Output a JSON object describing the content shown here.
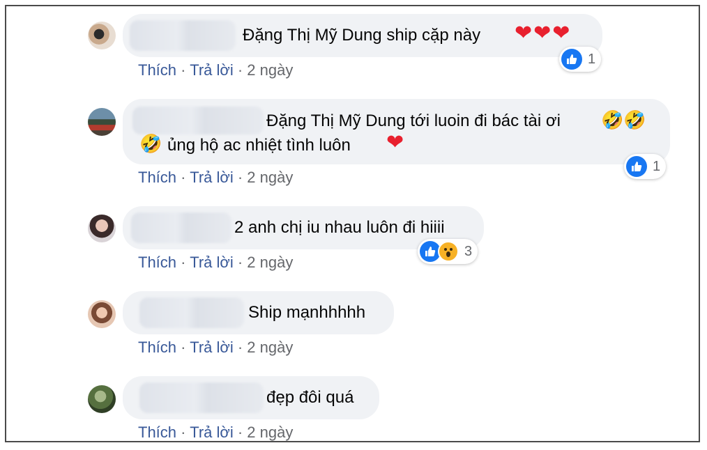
{
  "actions": {
    "like": "Thích",
    "reply": "Trả lời",
    "separator": "·"
  },
  "colors": {
    "bubble": "#f0f2f5",
    "link": "#385898",
    "meta": "#65676b",
    "like": "#1877f2",
    "heart": "#e8202e"
  },
  "comments": [
    {
      "text": "Đặng Thị Mỹ Dung ship cặp này",
      "emojis": "❤❤❤",
      "time": "2 ngày",
      "reaction": {
        "icons": [
          "like-icon"
        ],
        "count": "1"
      }
    },
    {
      "text": "Đặng Thị Mỹ Dung tới luoin đi bác tài ơi",
      "emojis_line1": "🤣🤣",
      "emoji_line2": "🤣",
      "text_line2": "ủng hộ ac nhiệt tình luôn",
      "heart_line2": "❤",
      "time": "2 ngày",
      "reaction": {
        "icons": [
          "like-icon"
        ],
        "count": "1"
      }
    },
    {
      "text": "2 anh chị iu nhau luôn đi hiiii",
      "time": "2 ngày",
      "reaction": {
        "icons": [
          "like-icon",
          "wow-icon"
        ],
        "count": "3"
      }
    },
    {
      "text": "Ship mạnhhhhh",
      "time": "2 ngày"
    },
    {
      "text": "đẹp đôi quá",
      "time": "2 ngày"
    }
  ]
}
